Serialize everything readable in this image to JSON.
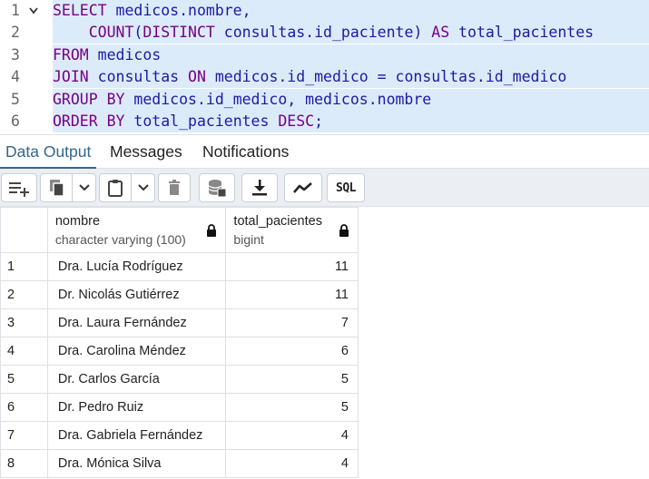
{
  "editor": {
    "lines": [
      {
        "num": "1",
        "fold": true,
        "tokens": [
          [
            "kw",
            "SELECT"
          ],
          [
            "pl",
            " medicos.nombre,"
          ]
        ]
      },
      {
        "num": "2",
        "fold": false,
        "tokens": [
          [
            "pl",
            "    "
          ],
          [
            "kw",
            "COUNT"
          ],
          [
            "pl",
            "("
          ],
          [
            "kw",
            "DISTINCT"
          ],
          [
            "pl",
            " consultas.id_paciente) "
          ],
          [
            "kw",
            "AS"
          ],
          [
            "pl",
            " total_pacientes"
          ]
        ]
      },
      {
        "num": "3",
        "fold": false,
        "tokens": [
          [
            "kw",
            "FROM"
          ],
          [
            "pl",
            " medicos"
          ]
        ]
      },
      {
        "num": "4",
        "fold": false,
        "tokens": [
          [
            "kw",
            "JOIN"
          ],
          [
            "pl",
            " consultas "
          ],
          [
            "kw",
            "ON"
          ],
          [
            "pl",
            " medicos.id_medico = consultas.id_medico"
          ]
        ]
      },
      {
        "num": "5",
        "fold": false,
        "tokens": [
          [
            "kw",
            "GROUP BY"
          ],
          [
            "pl",
            " medicos.id_medico, medicos.nombre"
          ]
        ]
      },
      {
        "num": "6",
        "fold": false,
        "tokens": [
          [
            "kw",
            "ORDER BY"
          ],
          [
            "pl",
            " total_pacientes "
          ],
          [
            "kw",
            "DESC"
          ],
          [
            "pl",
            ";"
          ]
        ]
      }
    ]
  },
  "tabs": {
    "data_output": "Data Output",
    "messages": "Messages",
    "notifications": "Notifications"
  },
  "toolbar": {
    "sql_label": "SQL"
  },
  "grid": {
    "columns": [
      {
        "name": "nombre",
        "type": "character varying (100)"
      },
      {
        "name": "total_pacientes",
        "type": "bigint"
      }
    ],
    "rows": [
      {
        "n": "1",
        "nombre": "Dra. Lucía Rodríguez",
        "total": "11"
      },
      {
        "n": "2",
        "nombre": "Dr. Nicolás Gutiérrez",
        "total": "11"
      },
      {
        "n": "3",
        "nombre": "Dra. Laura Fernández",
        "total": "7"
      },
      {
        "n": "4",
        "nombre": "Dra. Carolina Méndez",
        "total": "6"
      },
      {
        "n": "5",
        "nombre": "Dr. Carlos García",
        "total": "5"
      },
      {
        "n": "6",
        "nombre": "Dr. Pedro Ruiz",
        "total": "5"
      },
      {
        "n": "7",
        "nombre": "Dra. Gabriela Fernández",
        "total": "4"
      },
      {
        "n": "8",
        "nombre": "Dra. Mónica Silva",
        "total": "4"
      }
    ]
  },
  "colors": {
    "accent": "#326690",
    "selection": "#dcebfa",
    "keyword": "#770088",
    "identifier": "#1a1aa6"
  },
  "icons": [
    "add-row-icon",
    "copy-icon",
    "dropdown-icon",
    "paste-icon",
    "delete-icon",
    "save-data-icon",
    "download-icon",
    "graph-icon",
    "sql-icon",
    "lock-icon",
    "fold-chevron-icon"
  ]
}
